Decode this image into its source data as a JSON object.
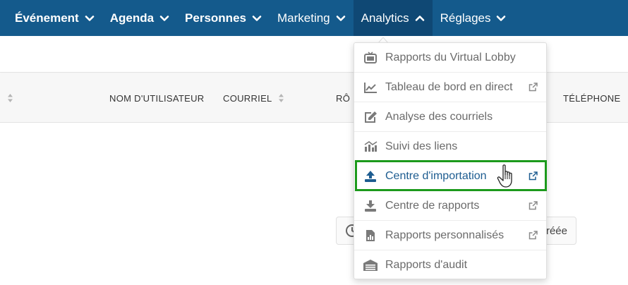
{
  "nav": {
    "items": [
      {
        "label": "Événement"
      },
      {
        "label": "Agenda"
      },
      {
        "label": "Personnes"
      },
      {
        "label": "Marketing"
      },
      {
        "label": "Analytics"
      },
      {
        "label": "Réglages"
      }
    ],
    "active": "Analytics"
  },
  "table": {
    "headers": {
      "username": "NOM D'UTILISATEUR",
      "email": "COURRIEL",
      "role": "RÔ",
      "phone": "TÉLÉPHONE"
    }
  },
  "background_chip": {
    "text_fragment": "réée"
  },
  "dropdown": {
    "items": [
      {
        "label": "Rapports du Virtual Lobby",
        "icon": "tv-icon",
        "external": false
      },
      {
        "label": "Tableau de bord en direct",
        "icon": "line-chart-icon",
        "external": true
      },
      {
        "label": "Analyse des courriels",
        "icon": "edit-icon",
        "external": false
      },
      {
        "label": "Suivi des liens",
        "icon": "bar-chart-icon",
        "external": false
      },
      {
        "label": "Centre d'importation",
        "icon": "upload-icon",
        "external": true,
        "highlighted": true
      },
      {
        "label": "Centre de rapports",
        "icon": "download-icon",
        "external": true
      },
      {
        "label": "Rapports personnalisés",
        "icon": "report-file-icon",
        "external": true
      },
      {
        "label": "Rapports d'audit",
        "icon": "archive-icon",
        "external": false
      }
    ]
  },
  "colors": {
    "nav_bg": "#145a8c",
    "nav_active_bg": "#0f4874",
    "highlight_border": "#1c9a1c",
    "highlight_text": "#1d5c90",
    "menu_text": "#6b6b6b"
  }
}
